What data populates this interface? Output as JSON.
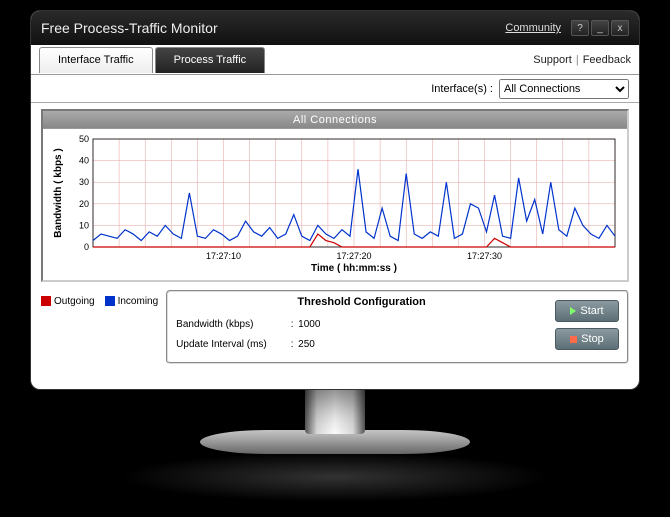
{
  "window": {
    "title": "Free Process-Traffic Monitor",
    "community_link": "Community",
    "help_btn": "?",
    "min_btn": "_",
    "close_btn": "x"
  },
  "tabs": {
    "interface": "Interface Traffic",
    "process": "Process Traffic"
  },
  "links": {
    "support": "Support",
    "feedback": "Feedback"
  },
  "interface_row": {
    "label": "Interface(s) :",
    "selected": "All Connections"
  },
  "chart": {
    "title": "All Connections",
    "ylabel": "Bandwidth ( kbps )",
    "xlabel": "Time ( hh:mm:ss )"
  },
  "legend": {
    "outgoing": "Outgoing",
    "incoming": "Incoming",
    "outgoing_color": "#cc0000",
    "incoming_color": "#0033cc"
  },
  "threshold": {
    "heading": "Threshold Configuration",
    "bandwidth_label": "Bandwidth (kbps)",
    "bandwidth_value": "1000",
    "interval_label": "Update Interval (ms)",
    "interval_value": "250",
    "start_label": "Start",
    "stop_label": "Stop"
  },
  "chart_data": {
    "type": "line",
    "xlabel": "Time ( hh:mm:ss )",
    "ylabel": "Bandwidth ( kbps )",
    "ylim": [
      0,
      50
    ],
    "yticks": [
      0,
      10,
      20,
      30,
      40,
      50
    ],
    "xticks": [
      "17:27:10",
      "17:27:20",
      "17:27:30"
    ],
    "series": [
      {
        "name": "Incoming",
        "color": "#0033cc",
        "values": [
          3,
          6,
          5,
          4,
          8,
          6,
          3,
          7,
          5,
          10,
          6,
          4,
          25,
          5,
          4,
          8,
          6,
          3,
          5,
          12,
          7,
          5,
          9,
          4,
          6,
          15,
          5,
          3,
          10,
          6,
          4,
          8,
          5,
          36,
          7,
          4,
          18,
          5,
          3,
          34,
          6,
          4,
          7,
          5,
          30,
          4,
          6,
          20,
          18,
          7,
          24,
          5,
          4,
          32,
          12,
          22,
          6,
          30,
          8,
          5,
          18,
          10,
          6,
          4,
          10,
          5
        ]
      },
      {
        "name": "Outgoing",
        "color": "#cc0000",
        "values": [
          0,
          0,
          0,
          0,
          0,
          0,
          0,
          0,
          0,
          0,
          0,
          0,
          0,
          0,
          0,
          0,
          0,
          0,
          0,
          0,
          0,
          0,
          0,
          0,
          0,
          0,
          0,
          0,
          6,
          3,
          2,
          0,
          0,
          0,
          0,
          0,
          0,
          0,
          0,
          0,
          0,
          0,
          0,
          0,
          0,
          0,
          0,
          0,
          0,
          0,
          4,
          2,
          0,
          0,
          0,
          0,
          0,
          0,
          0,
          0,
          0,
          0,
          0,
          0,
          0,
          0
        ]
      }
    ]
  }
}
